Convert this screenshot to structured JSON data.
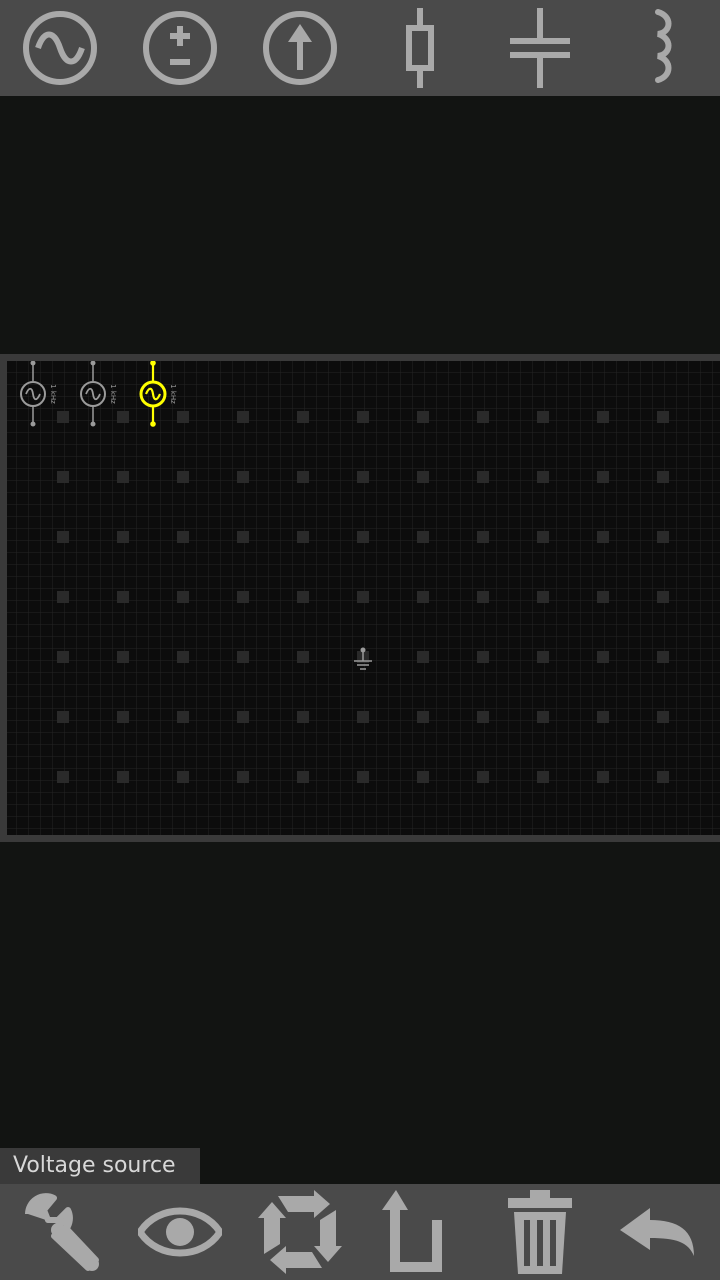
{
  "colors": {
    "toolbar_bg": "#4a4a4a",
    "icon_gray": "#a9a9a9",
    "board_bg": "#0c0c0c",
    "selected": "#ffff00",
    "component_gray": "#9a9a9a"
  },
  "top_toolbar": [
    {
      "icon": "ac-source-icon"
    },
    {
      "icon": "dc-source-icon"
    },
    {
      "icon": "current-source-icon"
    },
    {
      "icon": "resistor-icon"
    },
    {
      "icon": "capacitor-icon"
    },
    {
      "icon": "inductor-icon"
    }
  ],
  "board": {
    "components": [
      {
        "name": "ac-source-1",
        "label": "1 kHz",
        "selected": false
      },
      {
        "name": "ac-source-2",
        "label": "1 kHz",
        "selected": false
      },
      {
        "name": "ac-source-3",
        "label": "1 kHz",
        "selected": true
      }
    ],
    "ground": {
      "name": "ground-symbol"
    }
  },
  "status": {
    "toast": "Voltage source"
  },
  "bottom_toolbar": [
    {
      "icon": "wrench-icon"
    },
    {
      "icon": "eye-icon"
    },
    {
      "icon": "rotate-icon"
    },
    {
      "icon": "flip-icon"
    },
    {
      "icon": "trash-icon"
    },
    {
      "icon": "undo-icon"
    }
  ]
}
